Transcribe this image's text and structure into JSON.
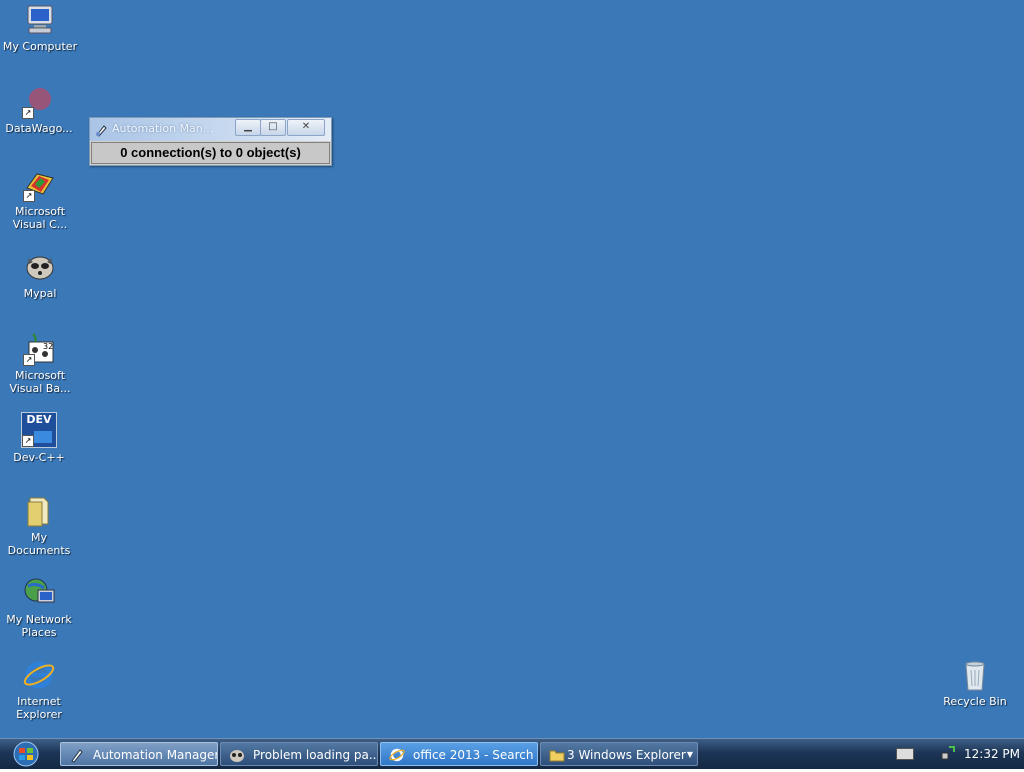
{
  "desktop": {
    "background_color": "#3a78b8",
    "icons": [
      {
        "label": "My Computer",
        "icon": "my-computer-icon"
      },
      {
        "label": "DataWago...",
        "icon": "datawagon-icon"
      },
      {
        "label": "Microsoft\nVisual C...",
        "icon": "visual-cpp-icon"
      },
      {
        "label": "Mypal",
        "icon": "mypal-icon"
      },
      {
        "label": "Microsoft\nVisual Ba...",
        "icon": "visual-basic-icon"
      },
      {
        "label": "Dev-C++",
        "icon": "devcpp-icon",
        "badge": "DEV"
      },
      {
        "label": "My\nDocuments",
        "icon": "my-documents-icon"
      },
      {
        "label": "My Network\nPlaces",
        "icon": "network-places-icon"
      },
      {
        "label": "Internet\nExplorer",
        "icon": "internet-explorer-icon"
      },
      {
        "label": "Recycle Bin",
        "icon": "recycle-bin-icon"
      }
    ]
  },
  "automation_window": {
    "title": "Automation Man...",
    "status": "0 connection(s) to 0 object(s)",
    "buttons": {
      "minimize": "minimize-icon",
      "maximize": "maximize-icon",
      "close": "close-icon"
    }
  },
  "taskbar": {
    "start_icon": "windows-start-icon",
    "tasks": [
      {
        "label": "Automation Manager",
        "icon": "automation-manager-icon",
        "state": "active"
      },
      {
        "label": "Problem loading pa...",
        "icon": "mypal-icon",
        "state": "normal"
      },
      {
        "label": "office 2013 - Search ...",
        "icon": "internet-explorer-icon",
        "state": "highlight"
      },
      {
        "label": "3 Windows Explorer",
        "icon": "folder-icon",
        "state": "normal",
        "has_dropdown": true
      }
    ],
    "tray": {
      "icons": [
        "keyboard-icon",
        "network-icon"
      ],
      "clock": "12:32 PM"
    }
  }
}
